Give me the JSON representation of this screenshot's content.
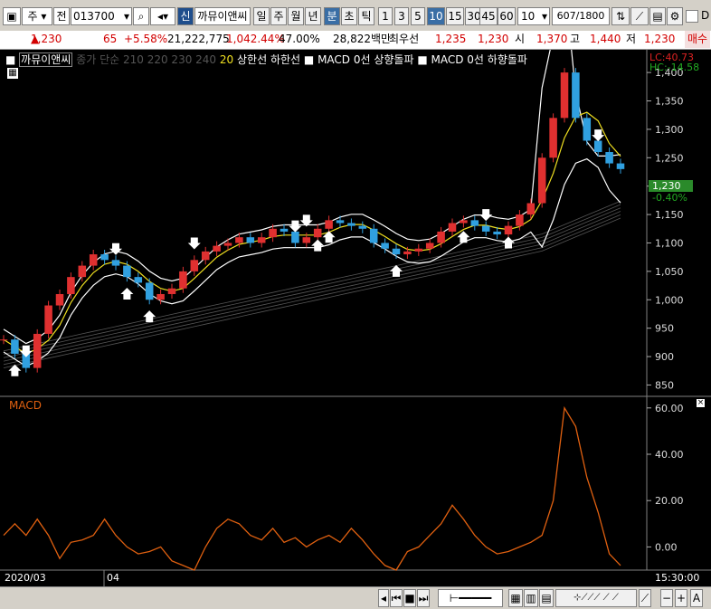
{
  "toolbar": {
    "market_type": "주",
    "prev_btn": "전",
    "code": "013700",
    "new_label": "신",
    "stock_name": "까뮤이앤씨",
    "periods": [
      "일",
      "주",
      "월",
      "년",
      "분",
      "초",
      "틱"
    ],
    "active_period": "분",
    "intervals": [
      "1",
      "3",
      "5",
      "10",
      "15",
      "30",
      "45",
      "60"
    ],
    "active_interval": "10",
    "interval_select": "10",
    "count": "607",
    "total": "/1800",
    "d_label": "D"
  },
  "info": {
    "price": "1,230",
    "change": "65",
    "change_pct": "+5.58%",
    "volume": "21,222,775",
    "volume_pct": "1,042.44%",
    "ratio": "47.00%",
    "amount": "28,822백만",
    "best_label": "최우선",
    "best_ask": "1,235",
    "best_bid": "1,230",
    "open_label": "시",
    "open": "1,370",
    "high_label": "고",
    "high": "1,440",
    "low_label": "저",
    "low": "1,230",
    "buy_label": "매수"
  },
  "legend": {
    "stock": "까뮤이앤씨",
    "ma_label": "종가 단순 210 220 230 240",
    "env_period": "20",
    "upper": "상한선",
    "lower": "하한선",
    "macd_up": "MACD 0선 상향돌파",
    "macd_down": "MACD 0선 하향돌파"
  },
  "price_axis": {
    "lc": "LC:40.73",
    "hc": "HC:-14.58",
    "current": "1,230",
    "current_pct": "-0.40%",
    "ticks": [
      "1,400",
      "1,350",
      "1,300",
      "1,250",
      "1,200",
      "1,150",
      "1,100",
      "1,050",
      "1,000",
      "950",
      "900",
      "850"
    ]
  },
  "macd": {
    "title": "MACD",
    "ticks": [
      "60.00",
      "40.00",
      "20.00",
      "0.00"
    ]
  },
  "time_axis": {
    "start": "2020/03",
    "mid": "04",
    "end": "15:30:00"
  },
  "colors": {
    "bg": "#000000",
    "up": "#e03030",
    "down": "#30a0e0",
    "ma": "#f0e020",
    "band": "#ffffff",
    "macd": "#e06010"
  },
  "chart_data": {
    "type": "line",
    "title": "",
    "price_ylim": [
      830,
      1440
    ],
    "macd_ylim": [
      -10,
      65
    ],
    "price_series": [
      {
        "name": "까뮤이앤씨",
        "values": [
          930,
          905,
          880,
          940,
          990,
          1010,
          1040,
          1060,
          1080,
          1070,
          1060,
          1040,
          1030,
          1000,
          1010,
          1020,
          1050,
          1070,
          1085,
          1095,
          1100,
          1110,
          1100,
          1110,
          1125,
          1120,
          1100,
          1110,
          1125,
          1140,
          1135,
          1130,
          1125,
          1100,
          1090,
          1080,
          1085,
          1090,
          1100,
          1120,
          1135,
          1140,
          1130,
          1120,
          1115,
          1130,
          1150,
          1170,
          1250,
          1320,
          1400,
          1320,
          1280,
          1260,
          1240,
          1230
        ]
      }
    ],
    "macd_series": [
      {
        "name": "MACD",
        "values": [
          5,
          10,
          5,
          12,
          5,
          -5,
          2,
          3,
          5,
          12,
          5,
          0,
          -3,
          -2,
          0,
          -6,
          -8,
          -10,
          0,
          8,
          12,
          10,
          5,
          3,
          8,
          2,
          4,
          0,
          3,
          5,
          2,
          8,
          3,
          -3,
          -8,
          -10,
          -2,
          0,
          5,
          10,
          18,
          12,
          5,
          0,
          -3,
          -2,
          0,
          2,
          5,
          20,
          60,
          52,
          30,
          15,
          -3,
          -8
        ]
      }
    ]
  }
}
